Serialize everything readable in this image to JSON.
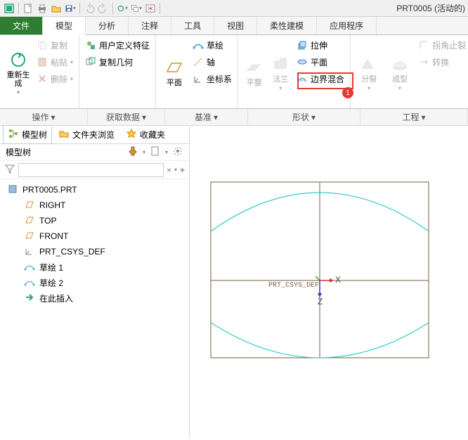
{
  "doc_title": "PRT0005 (活动的)",
  "tabs": {
    "file": "文件",
    "model": "模型",
    "analysis": "分析",
    "annotate": "注释",
    "tools": "工具",
    "view": "视图",
    "flex": "柔性建模",
    "app": "应用程序"
  },
  "ribbon": {
    "regen": "重新生成",
    "copy": "复制",
    "paste": "粘贴",
    "delete": "删除",
    "user_feature": "用户定义特征",
    "copy_geom": "复制几何",
    "plane": "平面",
    "sketch": "草绘",
    "axis": "轴",
    "csys": "坐标系",
    "flatten": "平整",
    "flange": "法兰",
    "extrude": "拉伸",
    "plane2": "平面",
    "boundary_blend": "边界混合",
    "split": "分裂",
    "form": "成型",
    "corner_relief": "拐角止裂",
    "convert": "转换",
    "groups": {
      "operate": "操作",
      "getdata": "获取数据",
      "datum": "基准",
      "shape": "形状",
      "engineering": "工程"
    }
  },
  "panel": {
    "model_tree_tab": "模型树",
    "folder_tab": "文件夹浏览",
    "fav_tab": "收藏夹",
    "title": "模型树",
    "filter_placeholder": ""
  },
  "tree": {
    "root": "PRT0005.PRT",
    "items": [
      "RIGHT",
      "TOP",
      "FRONT",
      "PRT_CSYS_DEF",
      "草绘 1",
      "草绘 2",
      "在此插入"
    ]
  },
  "canvas": {
    "csys_label": "PRT_CSYS_DEF",
    "axis_x": "X",
    "axis_z": "Z"
  },
  "callout": {
    "num1": "1"
  }
}
